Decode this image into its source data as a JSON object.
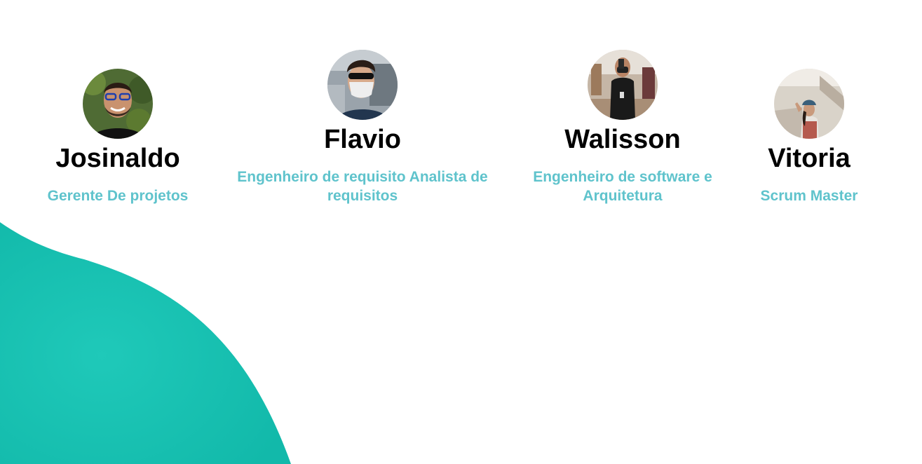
{
  "colors": {
    "accent_teal": "#15c3b5",
    "role_text": "#5fc3cc",
    "name_text": "#000000",
    "background": "#ffffff"
  },
  "team": [
    {
      "name": "Josinaldo",
      "role": "Gerente De projetos",
      "avatar": "avatar-photo-josinaldo"
    },
    {
      "name": "Flavio",
      "role": "Engenheiro de requisito Analista de requisitos",
      "avatar": "avatar-photo-flavio"
    },
    {
      "name": "Walisson",
      "role": "Engenheiro de software e Arquitetura",
      "avatar": "avatar-photo-walisson"
    },
    {
      "name": "Vitoria",
      "role": "Scrum Master",
      "avatar": "avatar-photo-vitoria"
    }
  ]
}
